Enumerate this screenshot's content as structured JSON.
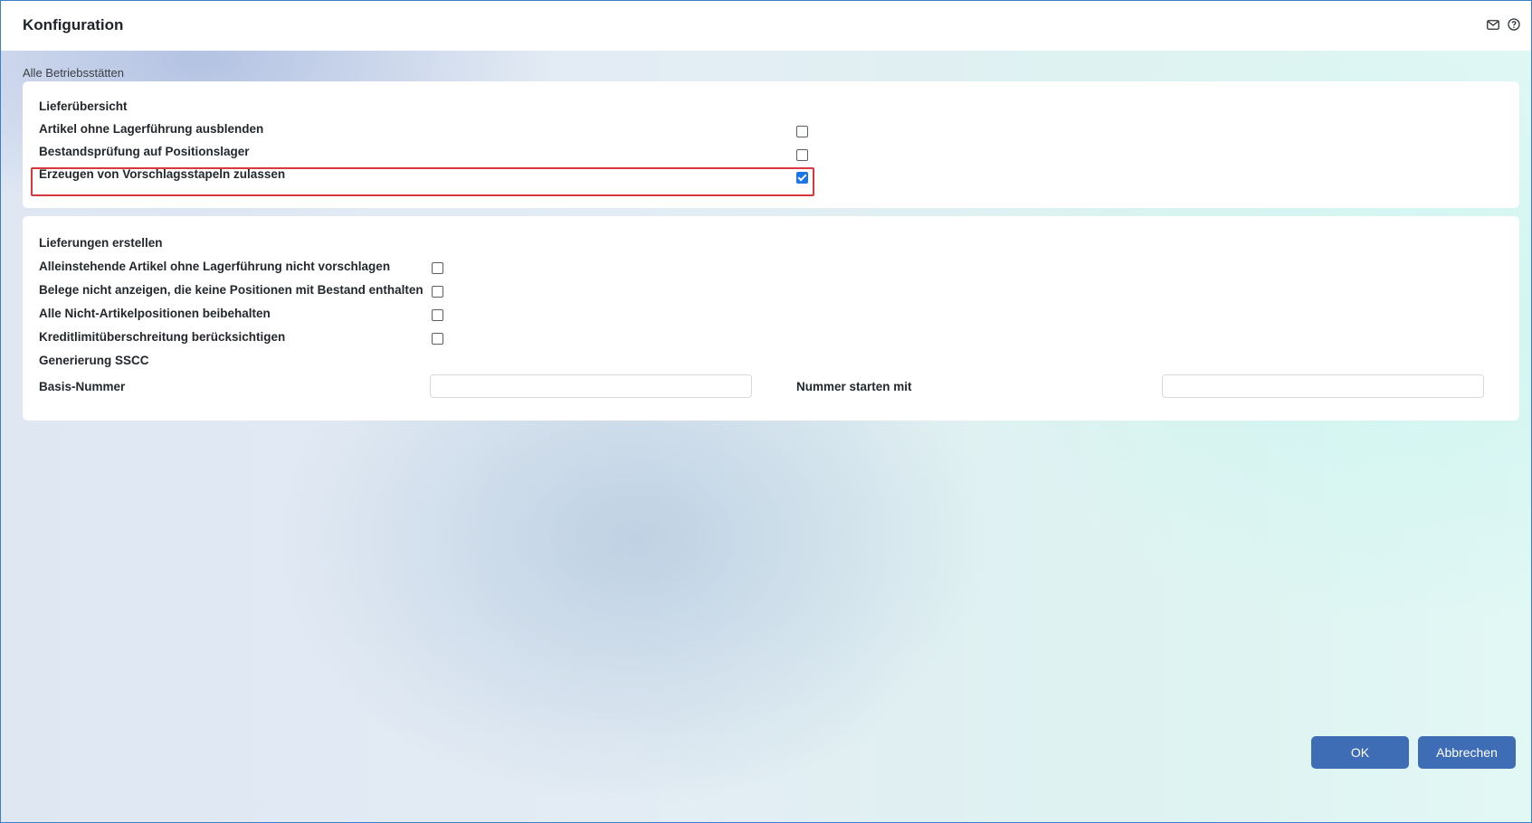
{
  "window": {
    "title": "Konfiguration",
    "icons": [
      "mail-icon",
      "help-icon"
    ]
  },
  "breadcrumb": "Alle Betriebsstätten",
  "section1": {
    "title": "Lieferübersicht",
    "options": [
      {
        "label": "Artikel ohne Lagerführung ausblenden",
        "checked": false
      },
      {
        "label": "Bestandsprüfung auf Positionslager",
        "checked": false
      },
      {
        "label": "Erzeugen von Vorschlagsstapeln zulassen",
        "checked": true
      }
    ]
  },
  "section2": {
    "title": "Lieferungen erstellen",
    "options": [
      {
        "label": "Alleinstehende Artikel ohne Lagerführung nicht vorschlagen",
        "checked": false
      },
      {
        "label": "Belege nicht anzeigen, die keine Positionen mit Bestand enthalten",
        "checked": false
      },
      {
        "label": "Alle Nicht-Artikelpositionen beibehalten",
        "checked": false
      },
      {
        "label": "Kreditlimitüberschreitung berücksichtigen",
        "checked": false
      }
    ],
    "sscc_title": "Generierung SSCC",
    "basis_label": "Basis-Nummer",
    "basis_value": "",
    "start_label": "Nummer starten mit",
    "start_value": ""
  },
  "footer": {
    "ok_label": "OK",
    "cancel_label": "Abbrechen"
  },
  "colors": {
    "accent": "#3f6db5",
    "checkbox_checked": "#1976e8",
    "highlight": "#d9393c"
  }
}
